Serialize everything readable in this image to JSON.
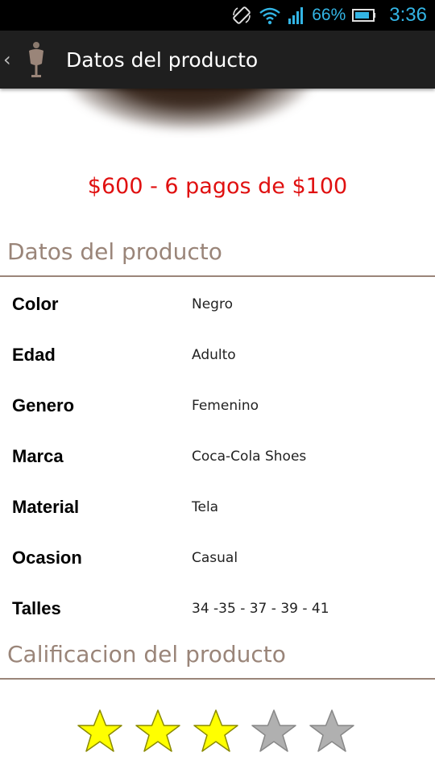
{
  "status_bar": {
    "battery_percent": "66%",
    "time": "3:36",
    "icons": [
      "screen-rotate-icon",
      "wifi-icon",
      "signal-icon",
      "battery-icon"
    ],
    "accent_color": "#33b5e5"
  },
  "action_bar": {
    "title": "Datos del producto",
    "back_icon": "chevron-left-icon",
    "app_icon": "mannequin-icon"
  },
  "price": {
    "text": "$600 - 6 pagos de $100",
    "color": "#e01010"
  },
  "details_section": {
    "header": "Datos del producto",
    "attributes": [
      {
        "label": "Color",
        "value": "Negro"
      },
      {
        "label": "Edad",
        "value": "Adulto"
      },
      {
        "label": "Genero",
        "value": "Femenino"
      },
      {
        "label": "Marca",
        "value": "Coca-Cola Shoes"
      },
      {
        "label": "Material",
        "value": "Tela"
      },
      {
        "label": "Ocasion",
        "value": "Casual"
      },
      {
        "label": "Talles",
        "value": "34 -35 - 37 - 39 - 41"
      }
    ]
  },
  "rating_section": {
    "header": "Calificacion del producto",
    "rating": 3,
    "max_rating": 5,
    "filled_color": "#ffff00",
    "empty_color": "#b0b0b0"
  }
}
